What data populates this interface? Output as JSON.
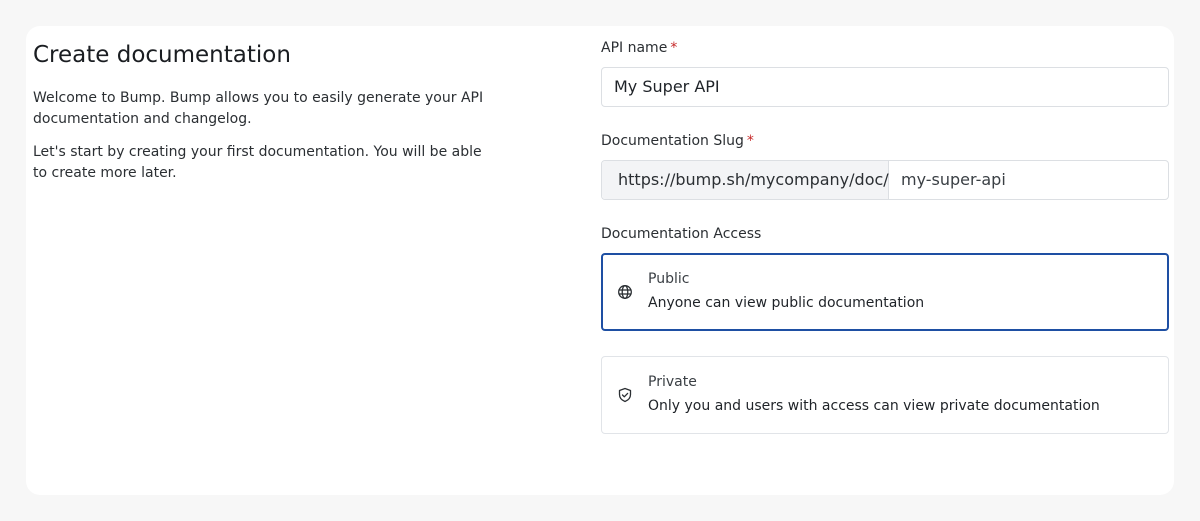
{
  "intro": {
    "title": "Create documentation",
    "paragraph1": "Welcome to Bump. Bump allows you to easily generate your API documentation and changelog.",
    "paragraph2": "Let's start by creating your first documentation. You will be able to create more later."
  },
  "form": {
    "api_name": {
      "label": "API name",
      "required_mark": "*",
      "value": "My Super API"
    },
    "slug": {
      "label": "Documentation Slug",
      "required_mark": "*",
      "prefix": "https://bump.sh/mycompany/doc/",
      "value": "my-super-api"
    },
    "access": {
      "label": "Documentation Access",
      "options": [
        {
          "icon": "globe-icon",
          "title": "Public",
          "description": "Anyone can view public documentation",
          "selected": true
        },
        {
          "icon": "shield-check-icon",
          "title": "Private",
          "description": "Only you and users with access can view private documentation",
          "selected": false
        }
      ]
    }
  },
  "colors": {
    "selected_border": "#1e4fa3",
    "required": "#c62828"
  }
}
